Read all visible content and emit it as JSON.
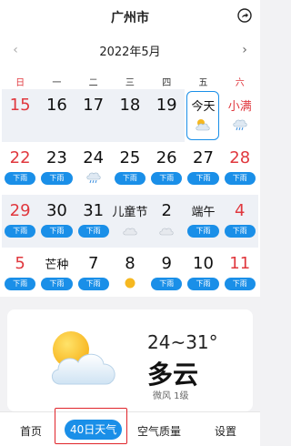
{
  "header": {
    "city": "广州市",
    "share_icon": "share-arrow-icon"
  },
  "calendar": {
    "month_label": "2022年5月",
    "prev_icon": "chevron-left-icon",
    "next_icon": "chevron-right-icon",
    "weekdays": [
      "日",
      "一",
      "二",
      "三",
      "四",
      "五",
      "六"
    ],
    "weeks": [
      [
        {
          "label": "15",
          "red": true,
          "weather": "",
          "bg": true
        },
        {
          "label": "16",
          "weather": "",
          "bg": true
        },
        {
          "label": "17",
          "weather": "",
          "bg": true
        },
        {
          "label": "18",
          "weather": "",
          "bg": true
        },
        {
          "label": "19",
          "weather": "",
          "bg": true
        },
        {
          "label": "今天",
          "small": true,
          "weather": "cloud-sun",
          "today": true
        },
        {
          "label": "小满",
          "small": true,
          "red": true,
          "weather": "rain-cloud"
        }
      ],
      [
        {
          "label": "22",
          "red": true,
          "weather": "下雨"
        },
        {
          "label": "23",
          "weather": "下雨"
        },
        {
          "label": "24",
          "weather": "rain-cloud"
        },
        {
          "label": "25",
          "weather": "下雨"
        },
        {
          "label": "26",
          "weather": "下雨"
        },
        {
          "label": "27",
          "weather": "下雨"
        },
        {
          "label": "28",
          "red": true,
          "weather": "下雨"
        }
      ],
      [
        {
          "label": "29",
          "red": true,
          "weather": "下雨",
          "bg": true
        },
        {
          "label": "30",
          "weather": "下雨",
          "bg": true
        },
        {
          "label": "31",
          "weather": "下雨",
          "bg": true
        },
        {
          "label": "儿童节",
          "small": true,
          "weather": "cloud",
          "bg": true
        },
        {
          "label": "2",
          "weather": "cloud",
          "bg": true
        },
        {
          "label": "端午",
          "small": true,
          "weather": "下雨",
          "bg": true
        },
        {
          "label": "4",
          "red": true,
          "weather": "下雨",
          "bg": true
        }
      ],
      [
        {
          "label": "5",
          "red": true,
          "weather": "下雨"
        },
        {
          "label": "芒种",
          "small": true,
          "weather": "下雨"
        },
        {
          "label": "7",
          "weather": "下雨"
        },
        {
          "label": "8",
          "weather": "sun"
        },
        {
          "label": "9",
          "weather": "下雨"
        },
        {
          "label": "10",
          "weather": "下雨"
        },
        {
          "label": "11",
          "red": true,
          "weather": "下雨"
        }
      ]
    ]
  },
  "today_card": {
    "icon": "cloudy-sun-icon",
    "temperature": "24~31°",
    "condition": "多云",
    "wind": "微风 1级"
  },
  "tabs": [
    {
      "label": "首页",
      "active": false
    },
    {
      "label": "40日天气",
      "active": true
    },
    {
      "label": "空气质量",
      "active": false
    },
    {
      "label": "设置",
      "active": false
    }
  ],
  "colors": {
    "accent": "#1a8fe8",
    "weekend_red": "#e0383e",
    "highlight_border": "#e0242a"
  }
}
